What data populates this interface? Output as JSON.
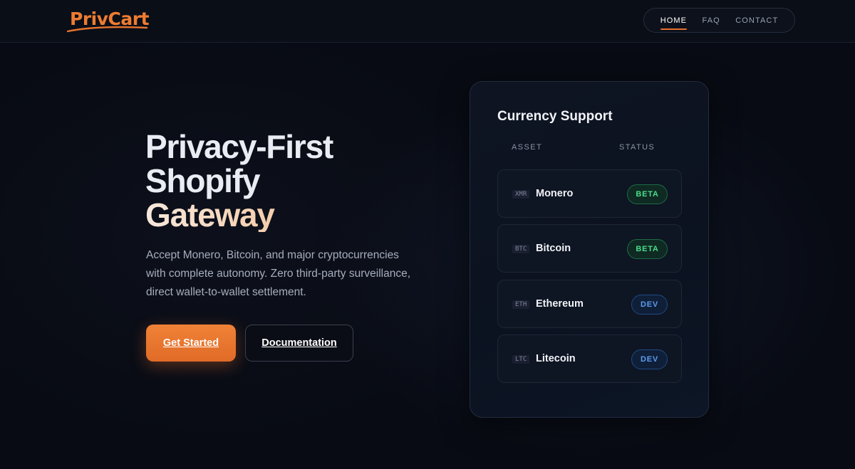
{
  "header": {
    "logo_text": "PrivCart",
    "nav": [
      {
        "label": "HOME",
        "active": true
      },
      {
        "label": "FAQ",
        "active": false
      },
      {
        "label": "CONTACT",
        "active": false
      }
    ]
  },
  "hero": {
    "title_line1": "Privacy-First",
    "title_line2": "Shopify",
    "title_line3": "Gateway",
    "description": "Accept Monero, Bitcoin, and major cryptocurrencies with complete autonomy. Zero third-party surveillance, direct wallet-to-wallet settlement.",
    "primary_button": "Get Started",
    "secondary_button": "Documentation"
  },
  "currency_card": {
    "title": "Currency Support",
    "col_asset": "ASSET",
    "col_status": "STATUS",
    "rows": [
      {
        "ticker": "XMR",
        "name": "Monero",
        "status": "BETA"
      },
      {
        "ticker": "BTC",
        "name": "Bitcoin",
        "status": "BETA"
      },
      {
        "ticker": "ETH",
        "name": "Ethereum",
        "status": "DEV"
      },
      {
        "ticker": "LTC",
        "name": "Litecoin",
        "status": "DEV"
      }
    ]
  },
  "colors": {
    "accent": "#e8742c",
    "beta": "#49dc8c",
    "dev": "#5d9cf0",
    "background": "#080b13"
  }
}
